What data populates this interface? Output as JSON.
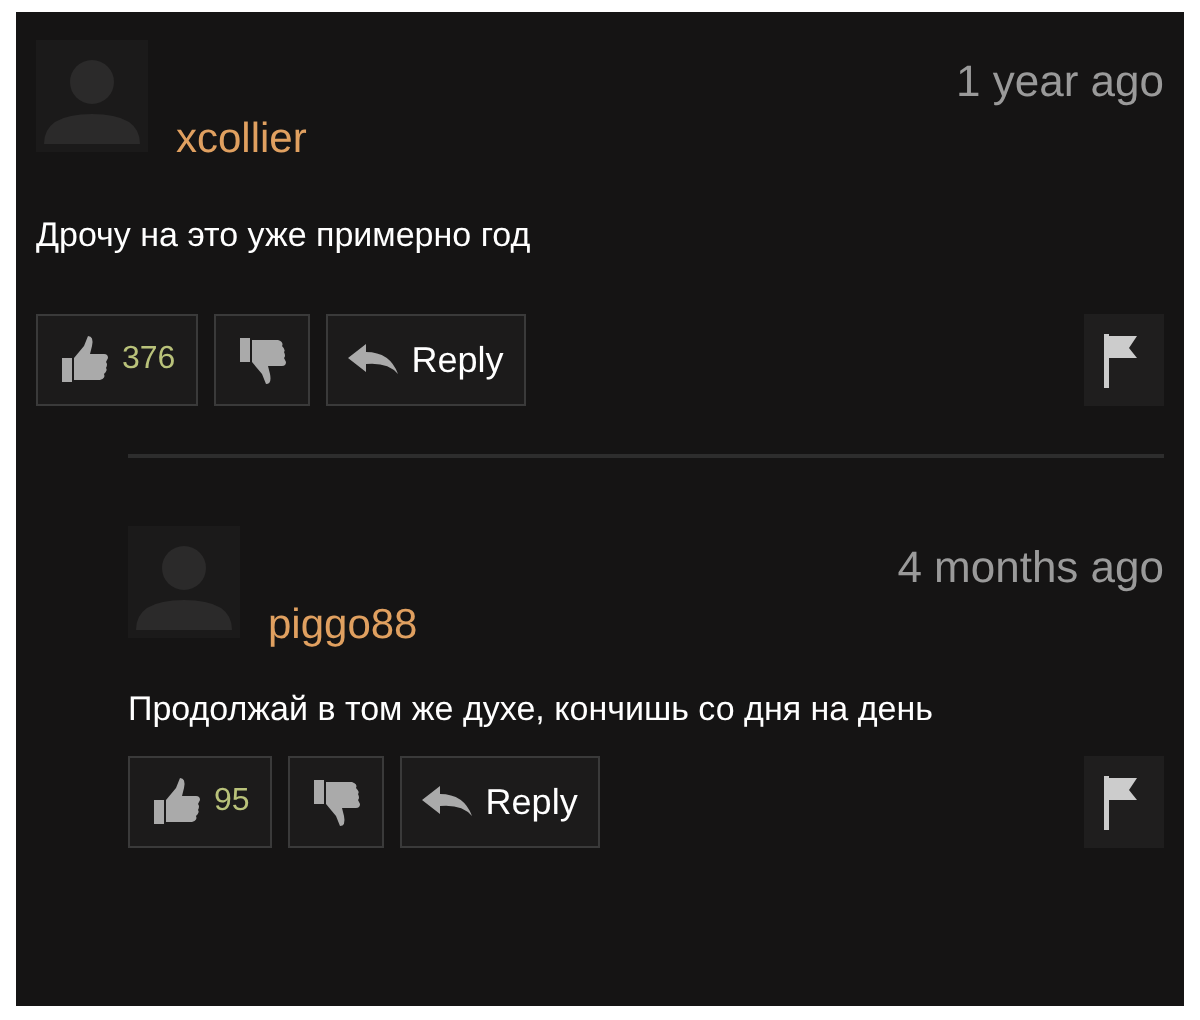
{
  "comments": [
    {
      "user": "xcollier",
      "time": "1 year ago",
      "text": "Дрочу на это уже примерно год",
      "likes": "376",
      "reply_label": "Reply",
      "children": [
        {
          "user": "piggo88",
          "time": "4 months ago",
          "text": "Продолжай в том же духе, кончишь со дня на день",
          "likes": "95",
          "reply_label": "Reply"
        }
      ]
    }
  ]
}
